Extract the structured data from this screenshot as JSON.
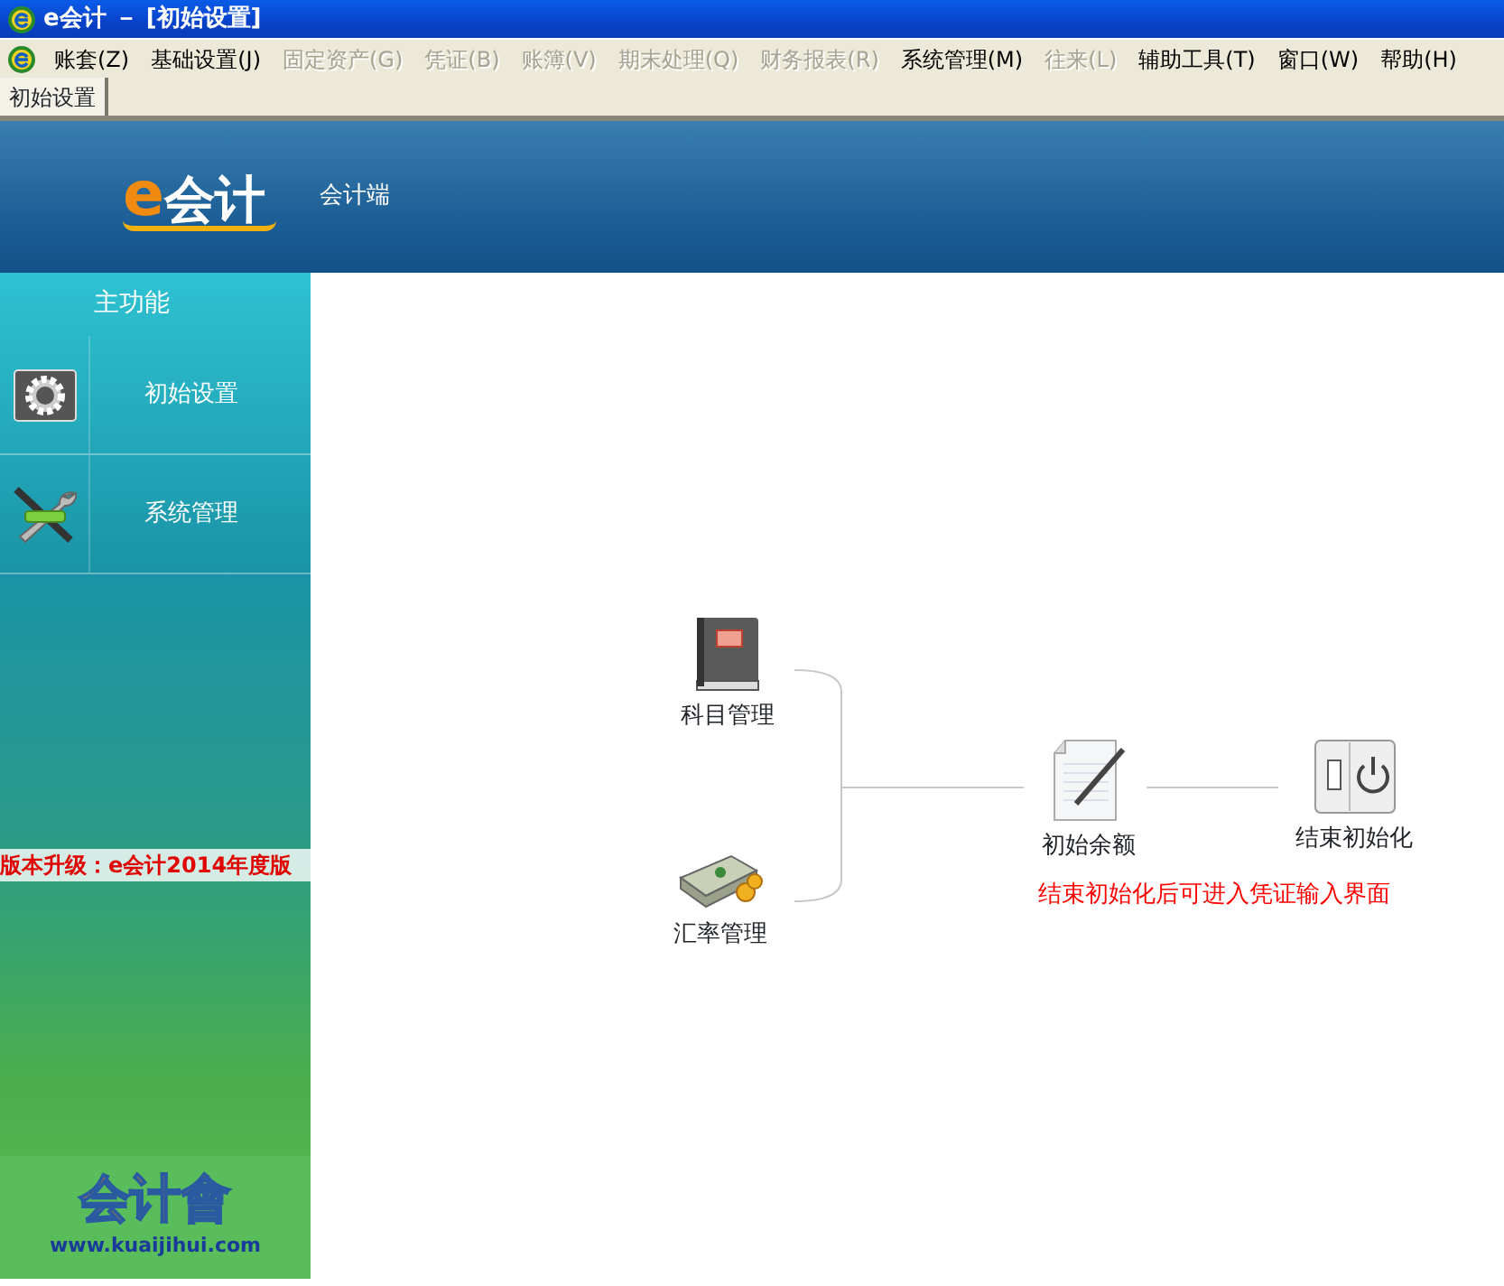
{
  "window": {
    "title": "e会计 － [初始设置]"
  },
  "menu": [
    {
      "label": "账套(Z)",
      "disabled": false
    },
    {
      "label": "基础设置(J)",
      "disabled": false
    },
    {
      "label": "固定资产(G)",
      "disabled": true
    },
    {
      "label": "凭证(B)",
      "disabled": true
    },
    {
      "label": "账簿(V)",
      "disabled": true
    },
    {
      "label": "期末处理(Q)",
      "disabled": true
    },
    {
      "label": "财务报表(R)",
      "disabled": true
    },
    {
      "label": "系统管理(M)",
      "disabled": false
    },
    {
      "label": "往来(L)",
      "disabled": true
    },
    {
      "label": "辅助工具(T)",
      "disabled": false
    },
    {
      "label": "窗口(W)",
      "disabled": false
    },
    {
      "label": "帮助(H)",
      "disabled": false
    }
  ],
  "doc_tabs": [
    {
      "label": "初始设置",
      "selected": true
    }
  ],
  "banner": {
    "logo_mark": "e",
    "logo_text": "会计",
    "subtitle": "会计端"
  },
  "sidebar": {
    "heading": "主功能",
    "items": [
      {
        "label": "初始设置",
        "kind": "gear"
      },
      {
        "label": "系统管理",
        "kind": "tools"
      }
    ],
    "notice": "版本升级：e会计2014年度版",
    "footer_logo": "会计會",
    "footer_url": "www.kuaijihui.com"
  },
  "diagram": {
    "nodes": [
      {
        "label": "科目管理",
        "kind": "book"
      },
      {
        "label": "汇率管理",
        "kind": "money"
      },
      {
        "label": "初始余额",
        "kind": "document"
      },
      {
        "label": "结束初始化",
        "kind": "switch"
      }
    ],
    "note": "结束初始化后可进入凭证输入界面"
  }
}
